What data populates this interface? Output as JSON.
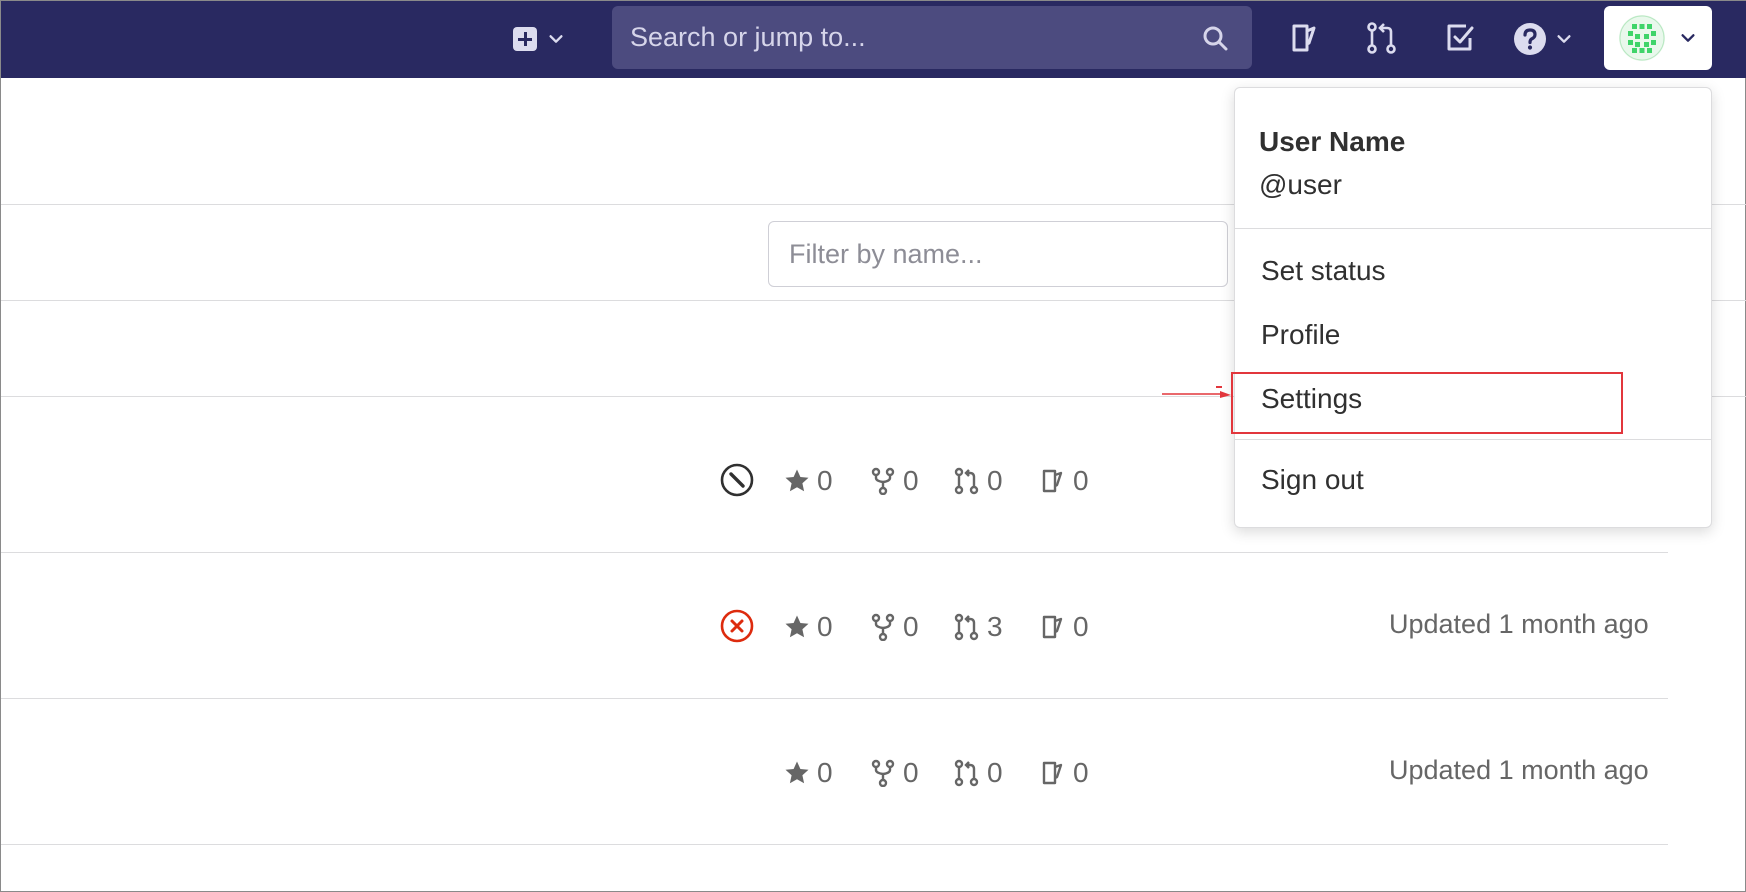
{
  "header": {
    "search_placeholder": "Search or jump to..."
  },
  "icons": {
    "new": "plus-square-icon",
    "search": "magnifier-icon",
    "issues": "issues-icon",
    "merge_requests": "merge-request-icon",
    "todos": "todo-icon",
    "help": "question-circle-icon",
    "avatar": "identicon-avatar"
  },
  "filter": {
    "placeholder": "Filter by name..."
  },
  "projects": [
    {
      "status": "pipeline-canceled",
      "stars": "0",
      "forks": "0",
      "merge_requests": "0",
      "issues": "0",
      "updated": ""
    },
    {
      "status": "pipeline-failed",
      "stars": "0",
      "forks": "0",
      "merge_requests": "3",
      "issues": "0",
      "updated": "Updated 1 month ago"
    },
    {
      "status": "",
      "stars": "0",
      "forks": "0",
      "merge_requests": "0",
      "issues": "0",
      "updated": "Updated 1 month ago"
    }
  ],
  "user_menu": {
    "name": "User Name",
    "handle": "@user",
    "items": [
      "Set status",
      "Profile",
      "Settings",
      "Sign out"
    ],
    "highlighted": "Settings"
  },
  "colors": {
    "navbar": "#292961",
    "search_bg": "#4c4b7f",
    "failed": "#dd2b0e",
    "highlight": "#e2363c"
  }
}
